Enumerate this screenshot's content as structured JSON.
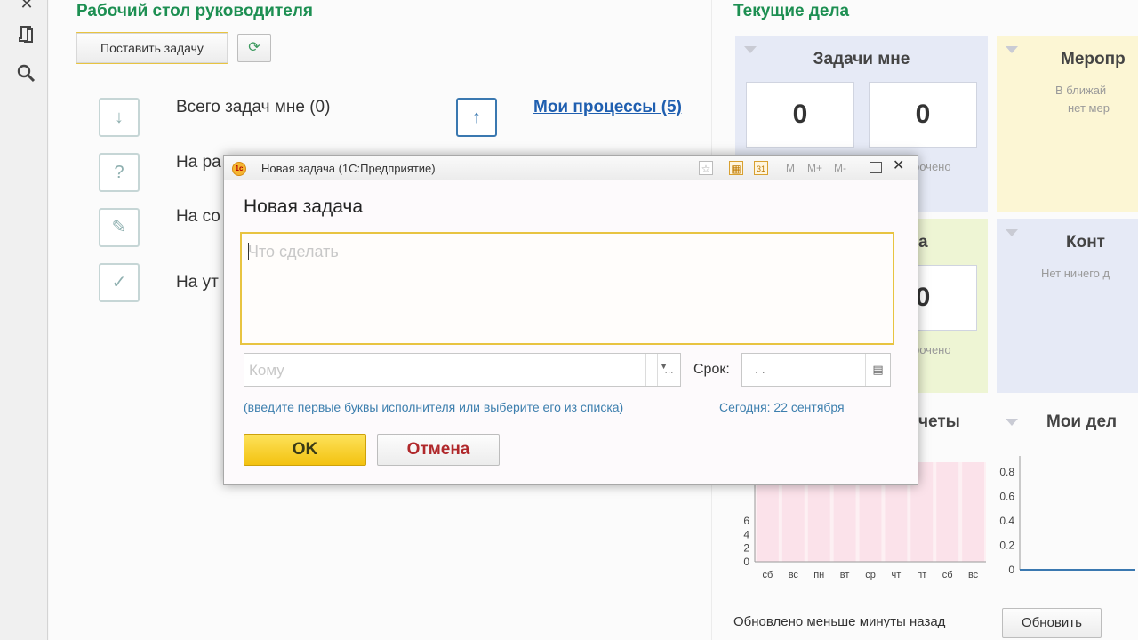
{
  "sidebar": {
    "icons": [
      "close-icon",
      "history-icon",
      "search-icon"
    ]
  },
  "desktop": {
    "title": "Рабочий стол руководителя",
    "assign_button": "Поставить задачу",
    "total_tasks": "Всего задач мне (0)",
    "my_processes": "Мои процессы (5)",
    "row_in_work": "На ра",
    "row_approval": "На со",
    "row_confirm": "На ут"
  },
  "current": {
    "title": "Текущие дела",
    "tasks_tile": {
      "title": "Задачи мне",
      "value1": "0",
      "value2": "0",
      "overdue": "рочено"
    },
    "events_tile": {
      "title": "Меропр",
      "line1": "В ближай",
      "line2": "нет мер"
    },
    "second_tile": {
      "title_fragment": "а",
      "value": "0",
      "overdue": "рочено"
    },
    "control_tile": {
      "title": "Конт",
      "text": "Нет ничего д"
    },
    "reports_title": "четы",
    "mydela_title": "Мои дел",
    "chart_left_yticks": [
      "0",
      "2",
      "4",
      "6"
    ],
    "chart_xticks": [
      "сб",
      "вс",
      "пн",
      "вт",
      "ср",
      "чт",
      "пт",
      "сб",
      "вс"
    ],
    "chart_right_yticks": [
      "0",
      "0.2",
      "0.4",
      "0.6",
      "0.8"
    ],
    "updated_text": "Обновлено меньше минуты назад",
    "refresh_button": "Обновить"
  },
  "modal": {
    "window_title": "Новая задача  (1С:Предприятие)",
    "heading": "Новая задача",
    "what_placeholder": "Что сделать",
    "to_placeholder": "Кому",
    "ellipsis": "...",
    "hint": "(введите первые буквы исполнителя или выберите его из списка)",
    "deadline_label": "Срок:",
    "date_placeholder": ". .",
    "today": "Сегодня: 22 сентября",
    "ok": "OK",
    "cancel": "Отмена",
    "toolbar": {
      "m": "M",
      "mplus": "M+",
      "mminus": "M-"
    }
  },
  "colors": {
    "accent_green": "#1d8f52",
    "link_blue": "#1f5fb0",
    "ok_yellow": "#f5cd2b",
    "cancel_red": "#b0282b",
    "tile_blue": "#e6eaf6",
    "tile_yellow": "#fcf6d4",
    "tile_green": "#eef5d4"
  },
  "chart_data": [
    {
      "type": "bar",
      "categories": [
        "сб",
        "вс",
        "пн",
        "вт",
        "ср",
        "чт",
        "пт",
        "сб",
        "вс"
      ],
      "values": [
        0,
        0,
        0,
        0,
        0,
        0,
        0,
        0,
        0
      ],
      "ylim": [
        0,
        6
      ]
    },
    {
      "type": "line",
      "values": [
        0,
        0
      ],
      "ylim": [
        0,
        0.8
      ]
    }
  ]
}
